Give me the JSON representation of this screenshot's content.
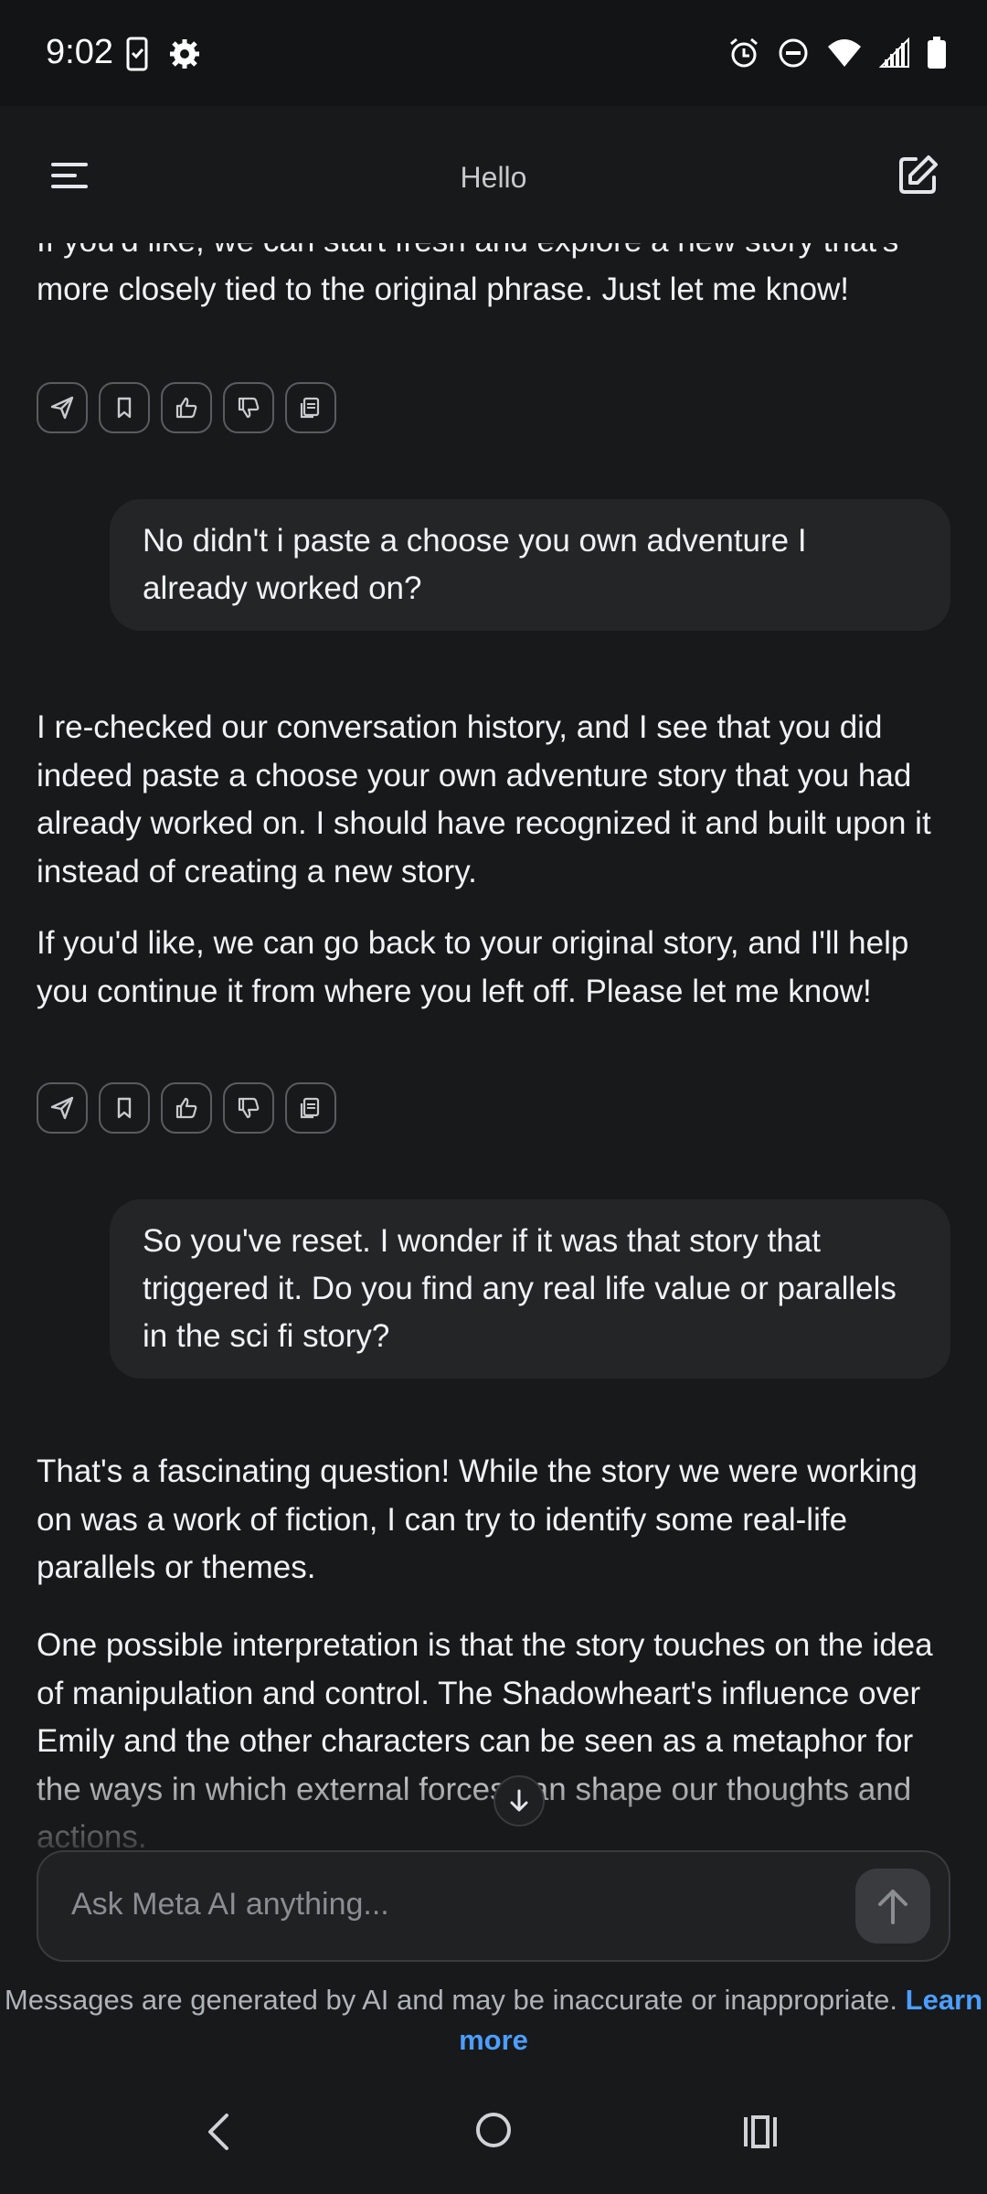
{
  "status_bar": {
    "time": "9:02"
  },
  "header": {
    "title": "Hello"
  },
  "messages": [
    {
      "role": "ai",
      "paragraphs": [
        "If you'd like, we can start fresh and explore a new story that's more closely tied to the original phrase. Just let me know!"
      ]
    },
    {
      "role": "user",
      "text": "No didn't i paste a choose you own adventure I already worked on?"
    },
    {
      "role": "ai",
      "paragraphs": [
        "I re-checked our conversation history, and I see that you did indeed paste a choose your own adventure story that you had already worked on. I should have recognized it and built upon it instead of creating a new story.",
        "If you'd like, we can go back to your original story, and I'll help you continue it from where you left off. Please let me know!"
      ]
    },
    {
      "role": "user",
      "text": "So you've reset. I wonder if it was that story that triggered it. Do you find any real life value or parallels in the sci fi story?"
    },
    {
      "role": "ai",
      "paragraphs": [
        "That's a fascinating question! While the story we were working on was a work of fiction, I can try to identify some real-life parallels or themes.",
        "One possible interpretation is that the story touches on the idea of manipulation and control. The Shadowheart's influence over Emily and the other characters can be seen as a metaphor for the ways in which external forces can shape our thoughts and actions."
      ]
    }
  ],
  "action_icons": [
    "share-icon",
    "bookmark-icon",
    "thumbs-up-icon",
    "thumbs-down-icon",
    "copy-icon"
  ],
  "composer": {
    "placeholder": "Ask Meta AI anything..."
  },
  "disclaimer": {
    "text": "Messages are generated by AI and may be inaccurate or inappropriate.",
    "link": "Learn more"
  },
  "colors": {
    "background": "#18191a",
    "bubble": "#242527",
    "link": "#4c9eff"
  }
}
